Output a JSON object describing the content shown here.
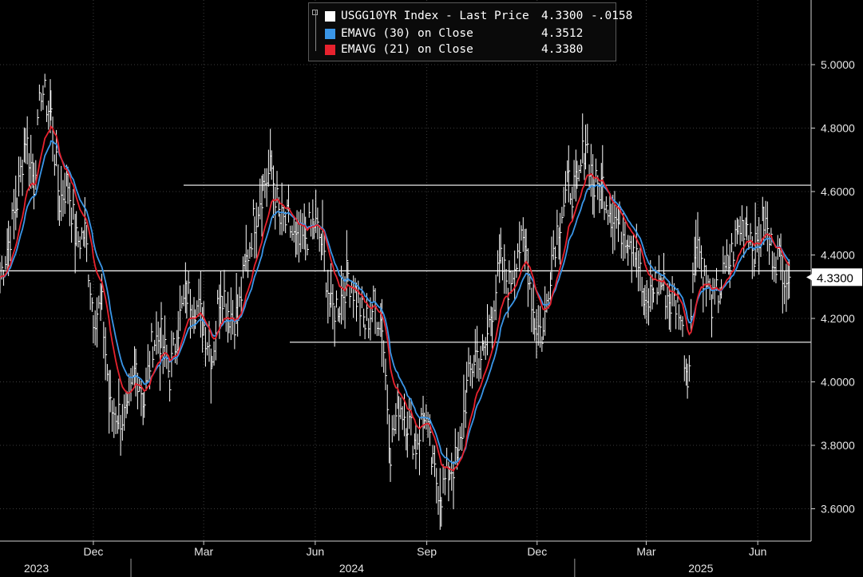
{
  "chart_data": {
    "type": "line",
    "title": "",
    "xlabel": "",
    "ylabel": "",
    "ylim": [
      3.5,
      5.1
    ],
    "y_ticks": [
      3.6,
      3.8,
      4.0,
      4.2,
      4.4,
      4.6,
      4.8,
      5.0
    ],
    "y_tick_labels": [
      "3.6000",
      "3.8000",
      "4.0000",
      "4.2000",
      "4.4000",
      "4.6000",
      "4.8000",
      "5.0000"
    ],
    "x_month_labels": [
      {
        "label": "Dec",
        "date": "2023-12-01"
      },
      {
        "label": "Mar",
        "date": "2024-03-01"
      },
      {
        "label": "Jun",
        "date": "2024-06-01"
      },
      {
        "label": "Sep",
        "date": "2024-09-01"
      },
      {
        "label": "Dec",
        "date": "2024-12-01"
      },
      {
        "label": "Mar",
        "date": "2025-03-01"
      },
      {
        "label": "Jun",
        "date": "2025-06-01"
      }
    ],
    "x_year_labels": [
      {
        "label": "2023",
        "date": "2023-10-15"
      },
      {
        "label": "2024",
        "date": "2024-07-01"
      },
      {
        "label": "2025",
        "date": "2025-04-15"
      }
    ],
    "x_range": [
      "2023-09-15",
      "2025-07-15"
    ],
    "grid": true,
    "legend": "top-center",
    "series": [
      {
        "name": "USGG10YR Index - Last Price",
        "kind": "bars",
        "color": "#ffffff",
        "last_value": "4.3300",
        "change": "-.0158",
        "x": [
          "2023-09-15",
          "2023-09-22",
          "2023-09-29",
          "2023-10-06",
          "2023-10-13",
          "2023-10-19",
          "2023-10-27",
          "2023-11-03",
          "2023-11-10",
          "2023-11-17",
          "2023-11-24",
          "2023-12-01",
          "2023-12-08",
          "2023-12-15",
          "2023-12-22",
          "2023-12-29",
          "2024-01-05",
          "2024-01-12",
          "2024-01-19",
          "2024-01-26",
          "2024-02-02",
          "2024-02-09",
          "2024-02-16",
          "2024-02-23",
          "2024-03-01",
          "2024-03-08",
          "2024-03-15",
          "2024-03-22",
          "2024-03-29",
          "2024-04-05",
          "2024-04-12",
          "2024-04-19",
          "2024-04-26",
          "2024-05-03",
          "2024-05-10",
          "2024-05-17",
          "2024-05-24",
          "2024-05-31",
          "2024-06-07",
          "2024-06-14",
          "2024-06-21",
          "2024-06-28",
          "2024-07-05",
          "2024-07-12",
          "2024-07-19",
          "2024-07-26",
          "2024-08-02",
          "2024-08-09",
          "2024-08-16",
          "2024-08-23",
          "2024-08-30",
          "2024-09-06",
          "2024-09-13",
          "2024-09-20",
          "2024-09-27",
          "2024-10-04",
          "2024-10-11",
          "2024-10-18",
          "2024-10-25",
          "2024-11-01",
          "2024-11-08",
          "2024-11-15",
          "2024-11-22",
          "2024-11-29",
          "2024-12-06",
          "2024-12-13",
          "2024-12-20",
          "2024-12-27",
          "2025-01-03",
          "2025-01-10",
          "2025-01-17",
          "2025-01-24",
          "2025-01-31",
          "2025-02-07",
          "2025-02-14",
          "2025-02-21",
          "2025-02-28",
          "2025-03-07",
          "2025-03-14",
          "2025-03-21",
          "2025-03-28",
          "2025-04-04",
          "2025-04-11",
          "2025-04-18",
          "2025-04-25",
          "2025-05-02",
          "2025-05-09",
          "2025-05-16",
          "2025-05-23",
          "2025-05-30",
          "2025-06-06",
          "2025-06-13",
          "2025-06-20",
          "2025-06-27"
        ],
        "values": [
          4.33,
          4.44,
          4.57,
          4.78,
          4.63,
          4.93,
          4.84,
          4.57,
          4.63,
          4.44,
          4.47,
          4.22,
          4.23,
          3.91,
          3.9,
          3.88,
          4.05,
          3.94,
          4.13,
          4.14,
          4.02,
          4.18,
          4.28,
          4.25,
          4.18,
          4.08,
          4.31,
          4.22,
          4.2,
          4.38,
          4.52,
          4.62,
          4.67,
          4.5,
          4.5,
          4.42,
          4.46,
          4.5,
          4.43,
          4.22,
          4.25,
          4.34,
          4.27,
          4.18,
          4.24,
          4.19,
          3.79,
          3.94,
          3.88,
          3.8,
          3.91,
          3.72,
          3.65,
          3.73,
          3.75,
          3.98,
          4.09,
          4.08,
          4.24,
          4.37,
          4.3,
          4.43,
          4.41,
          4.19,
          4.15,
          4.4,
          4.52,
          4.62,
          4.6,
          4.77,
          4.61,
          4.62,
          4.54,
          4.49,
          4.47,
          4.43,
          4.21,
          4.31,
          4.31,
          4.25,
          4.25,
          4.01,
          4.48,
          4.33,
          4.24,
          4.31,
          4.38,
          4.48,
          4.51,
          4.41,
          4.51,
          4.41,
          4.38,
          4.33
        ]
      },
      {
        "name": "EMAVG (30)  on Close",
        "color": "#3a96e8",
        "last_value": "4.3512"
      },
      {
        "name": "EMAVG (21)  on Close",
        "color": "#e8222e",
        "last_value": "4.3380"
      }
    ],
    "reference_lines": [
      {
        "value": 4.62,
        "color": "#ffffff"
      },
      {
        "value": 4.35,
        "color": "#ffffff"
      },
      {
        "value": 4.125,
        "color": "#ffffff"
      }
    ],
    "last_price_tag": {
      "value": 4.33,
      "label": "4.3300"
    }
  }
}
